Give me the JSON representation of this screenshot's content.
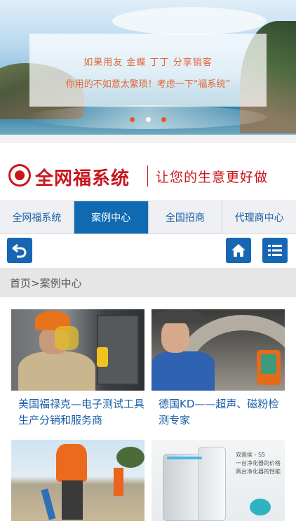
{
  "banner": {
    "line1": "如果用友  金蝶  丁丁  分享销客",
    "line2": "你用的不如意太繁琐！考虑一下“福系统”",
    "dots": [
      "active",
      "inactive",
      "active"
    ]
  },
  "logo": {
    "seal_text": "福",
    "name": "全网福系统",
    "slogan": "让您的生意更好做"
  },
  "nav": {
    "items": [
      {
        "label": "全网福系统",
        "active": false
      },
      {
        "label": "案例中心",
        "active": true
      },
      {
        "label": "全国招商",
        "active": false
      },
      {
        "label": "代理商中心",
        "active": false
      }
    ]
  },
  "toolbar": {
    "back_icon": "back-arrow-icon",
    "home_icon": "home-icon",
    "menu_icon": "list-menu-icon"
  },
  "breadcrumb": {
    "text": "首页>案例中心"
  },
  "cases": [
    {
      "title": "美国福禄克—电子测试工具生产分销和服务商"
    },
    {
      "title": "德国KD——超声、磁粉检测专家"
    },
    {
      "title": ""
    },
    {
      "title": ""
    }
  ],
  "card4_overlay": {
    "line1": "双面侯 - S5",
    "line2": "一台净化器的价格",
    "line3": "两台净化器的性能"
  },
  "colors": {
    "brand_red": "#c9161d",
    "nav_active": "#0f6ab2",
    "link_blue": "#1a5fa8",
    "toolbar_button": "#1766b4",
    "banner_text": "#e0673a"
  }
}
